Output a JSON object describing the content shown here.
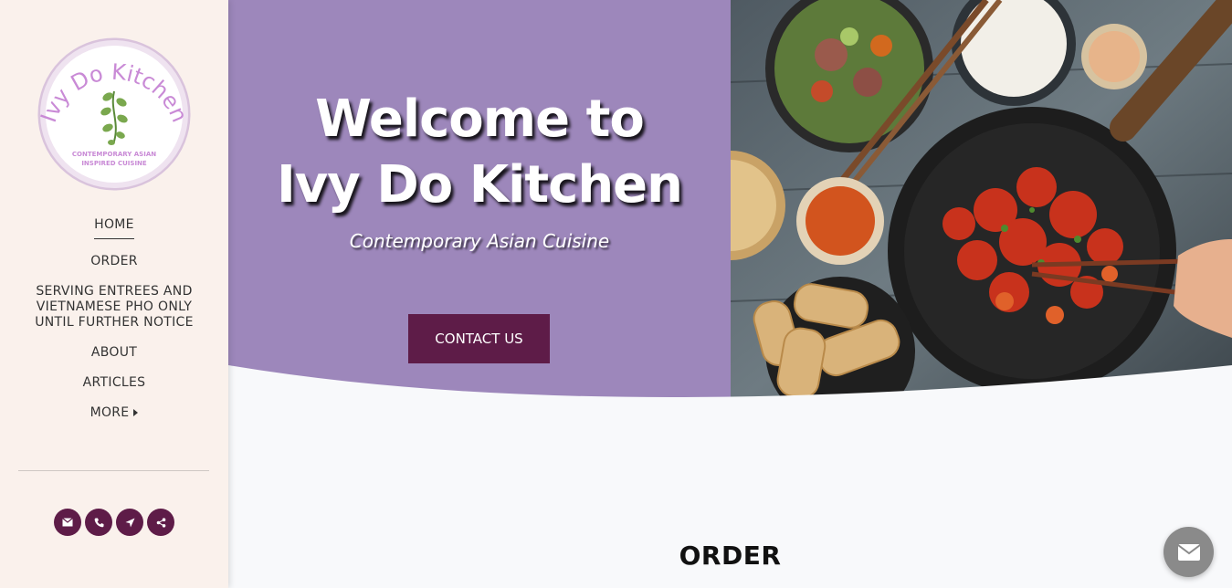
{
  "logo": {
    "name": "Ivy Do Kitchen",
    "tagline_line1": "CONTEMPORARY ASIAN",
    "tagline_line2": "INSPIRED CUISINE"
  },
  "nav": {
    "home": "HOME",
    "order": "ORDER",
    "notice_line1": "SERVING ENTREES AND",
    "notice_line2": "VIETNAMESE PHO ONLY",
    "notice_line3": "UNTIL FURTHER NOTICE",
    "about": "ABOUT",
    "articles": "ARTICLES",
    "more": "MORE"
  },
  "socials": [
    "mail-icon",
    "phone-icon",
    "location-icon",
    "share-icon"
  ],
  "hero": {
    "title_line1": "Welcome to",
    "title_line2": "Ivy Do Kitchen",
    "subtitle": "Contemporary Asian Cuisine",
    "cta_label": "CONTACT US"
  },
  "section": {
    "title": "ORDER"
  },
  "colors": {
    "sidebar_bg": "#faf1ec",
    "hero_purple": "#9d87bb",
    "accent": "#5e1c48",
    "page_bg": "#f8f9fb"
  }
}
